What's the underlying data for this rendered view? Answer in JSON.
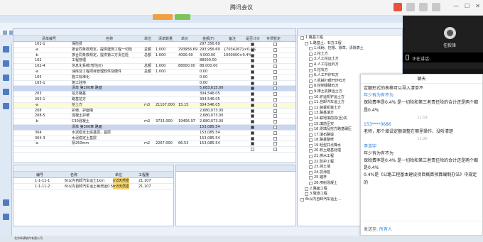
{
  "meeting": {
    "title": "腾讯会议"
  },
  "video": {
    "name": "任毅锋",
    "speaking": "正在讲话:"
  },
  "chat": {
    "title": "聊天",
    "messages": [
      {
        "text": "定额形式的表格可以导入清单不"
      },
      {
        "sender": "年少有为有不为"
      },
      {
        "text": "保险费率是0.4% 是一切险和第三者责任险的合计还是两个都是0.4%"
      },
      {
        "time": "11:19"
      },
      {
        "sender": "153****0686"
      },
      {
        "text": "老师，那个增设定额调整在哪里操作，没听清楚"
      },
      {
        "time": "11:26"
      },
      {
        "sender": "李浩宇"
      },
      {
        "text": "年少有为有不为"
      },
      {
        "text": "保险费率是0.4% 是一切险和第三者责任险的合计还是两个都是0.4%"
      },
      {
        "text": "0.4%是《公路工程基本建设项目概算预算编制办法》中规定的"
      }
    ],
    "send_to_label": "发送至:",
    "send_to_value": "所有人"
  },
  "grid": {
    "headers": [
      "清单编号",
      "名称",
      "单位",
      "清单数量",
      "单价",
      "金额(F)",
      "备注",
      "是否计价",
      "专项暂定"
    ],
    "rows": [
      {
        "code": "101-1",
        "name": "保险费",
        "unit": "",
        "qty": "",
        "price": "",
        "amount": "297,356.69",
        "note": "",
        "calc": true,
        "hl": false
      },
      {
        "code": "-a",
        "name": "按合同条款规定，提供建筑工程一切险",
        "unit": "总额",
        "qty": "1.000",
        "price": "293956.69",
        "amount": "293,956.69",
        "note": "{7034267}×0.4%",
        "calc": true,
        "hl": false
      },
      {
        "code": "-b",
        "name": "按合同条款规定，提供第三方责任险",
        "unit": "总额",
        "qty": "1.000",
        "price": "4000.00",
        "amount": "4,000.00",
        "note": "1000000×0.4%",
        "calc": true,
        "hl": false
      },
      {
        "code": "102",
        "name": "工程管理",
        "unit": "",
        "qty": "",
        "price": "",
        "amount": "88000.00",
        "note": "",
        "calc": true,
        "hl": false
      },
      {
        "code": "102-4",
        "name": "信息化系统(暂估价)",
        "unit": "总额",
        "qty": "1.000",
        "price": "88000.00",
        "amount": "88,000.00",
        "note": "",
        "calc": true,
        "hl": false
      },
      {
        "code": "-a",
        "name": "油库及工程项目管理软件及硬件",
        "unit": "总额",
        "qty": "1.000",
        "price": "",
        "amount": "0.00",
        "note": "",
        "calc": true,
        "hl": false
      },
      {
        "code": "105",
        "name": "施工标准化",
        "unit": "",
        "qty": "",
        "price": "",
        "amount": "0.00",
        "note": "",
        "calc": true,
        "hl": false
      },
      {
        "code": "105-1",
        "name": "施工驻地",
        "unit": "",
        "qty": "",
        "price": "",
        "amount": "0.00",
        "note": "",
        "calc": true,
        "hl": false
      },
      {
        "code": "",
        "name": "清单 第200章 路基",
        "unit": "",
        "qty": "",
        "price": "",
        "amount": "5,683,615.00",
        "note": "",
        "calc": true,
        "hl": true
      },
      {
        "code": "203",
        "name": "挖方路基",
        "unit": "",
        "qty": "",
        "price": "",
        "amount": "304,546.05",
        "note": "",
        "calc": true,
        "hl": false
      },
      {
        "code": "203-1",
        "name": "路基挖方",
        "unit": "",
        "qty": "",
        "price": "",
        "amount": "304,546.05",
        "note": "",
        "calc": true,
        "hl": false
      },
      {
        "code": "-a",
        "name": "挖土方",
        "unit": "m3",
        "qty": "21107.000",
        "price": "15.15",
        "amount": "304,546.05",
        "note": "",
        "calc": true,
        "hl": false,
        "sel": true
      },
      {
        "code": "208",
        "name": "护坡、护面墙",
        "unit": "",
        "qty": "",
        "price": "",
        "amount": "2,680,073.00",
        "note": "",
        "calc": true,
        "hl": false
      },
      {
        "code": "208-5",
        "name": "混凝土护坡",
        "unit": "",
        "qty": "",
        "price": "",
        "amount": "2,680,073.00",
        "note": "",
        "calc": true,
        "hl": false
      },
      {
        "code": "-b",
        "name": "C30混凝土",
        "unit": "m3",
        "qty": "3733.000",
        "price": "19406.97",
        "amount": "2,680,073.00",
        "note": "",
        "calc": true,
        "hl": false
      },
      {
        "code": "",
        "name": "清单 第300章 路面",
        "unit": "",
        "qty": "",
        "price": "",
        "amount": "153,085.54",
        "note": "",
        "calc": true,
        "hl": true
      },
      {
        "code": "304",
        "name": "水泥稳定土底基层、基层",
        "unit": "",
        "qty": "",
        "price": "",
        "amount": "153,085.54",
        "note": "",
        "calc": true,
        "hl": false
      },
      {
        "code": "304-3",
        "name": "水泥稳定土基层",
        "unit": "",
        "qty": "",
        "price": "",
        "amount": "153,085.54",
        "note": "",
        "calc": true,
        "hl": false
      },
      {
        "code": "-a",
        "name": "厚250mm",
        "unit": "m2",
        "qty": "2267.000",
        "price": "66.53",
        "amount": "153,085.54",
        "note": "",
        "calc": true,
        "hl": false
      },
      {
        "code": "",
        "name": "",
        "unit": "",
        "qty": "",
        "price": "",
        "amount": "",
        "note": "",
        "calc": false,
        "hl": false
      }
    ]
  },
  "lower": {
    "headers": [
      "编号",
      "名称",
      "单位",
      "工程量"
    ],
    "rows": [
      {
        "no": "1-1-11-1",
        "name": "6t以内自卸汽车运土1km",
        "unit": "m3天然密",
        "qty": "21.107"
      },
      {
        "no": "1-1-11-2",
        "name": "6t以内自卸汽车运土每增运0.5km",
        "unit": "m3天然密",
        "qty": "21.107"
      }
    ]
  },
  "tree": {
    "rows": [
      {
        "l": 0,
        "t": "1.路基工程"
      },
      {
        "l": 1,
        "t": "1.路基土、石方工程"
      },
      {
        "l": 2,
        "t": "1.伐树、挖根、除草、清除表土"
      },
      {
        "l": 2,
        "t": "2.挖土方"
      },
      {
        "l": 2,
        "t": "3.人工挖运土方"
      },
      {
        "l": 2,
        "t": "4.人工挖运石方"
      },
      {
        "l": 2,
        "t": "5.挖石方"
      },
      {
        "l": 2,
        "t": "6.人工开炸石方"
      },
      {
        "l": 2,
        "t": "7.机械打眼开炸石方"
      },
      {
        "l": 2,
        "t": "8.控制爆破石方"
      },
      {
        "l": 2,
        "t": "9.推土机推运土方"
      },
      {
        "l": 2,
        "t": "10.铲运机铲运土方"
      },
      {
        "l": 2,
        "t": "11.自卸汽车运土方"
      },
      {
        "l": 2,
        "t": "12.装载机装土方"
      },
      {
        "l": 2,
        "t": "13.路基填方"
      },
      {
        "l": 2,
        "t": "14.耕地填前夯(压)实"
      },
      {
        "l": 2,
        "t": "15.填前压实"
      },
      {
        "l": 2,
        "t": "16.零填及挖方路基碾压"
      },
      {
        "l": 2,
        "t": "17.填石路堤"
      },
      {
        "l": 2,
        "t": "18.路基整修"
      },
      {
        "l": 2,
        "t": "19.轻型井点降水"
      },
      {
        "l": 2,
        "t": "20.软土路基处理"
      },
      {
        "l": 2,
        "t": "21.排水工程"
      },
      {
        "l": 2,
        "t": "22.防护工程"
      },
      {
        "l": 2,
        "t": "23.挡土墙"
      },
      {
        "l": 2,
        "t": "24.抗滑桩"
      },
      {
        "l": 2,
        "t": "25.锚杆"
      },
      {
        "l": 2,
        "t": "26.喷射混凝土"
      },
      {
        "l": 1,
        "t": "2.路面工程"
      },
      {
        "l": 1,
        "t": "3.隧道工程"
      },
      {
        "l": 0,
        "t": "6t以内自卸汽车运土..."
      }
    ]
  },
  "taskbar": {
    "text": "北京纵横软件有限公司"
  }
}
